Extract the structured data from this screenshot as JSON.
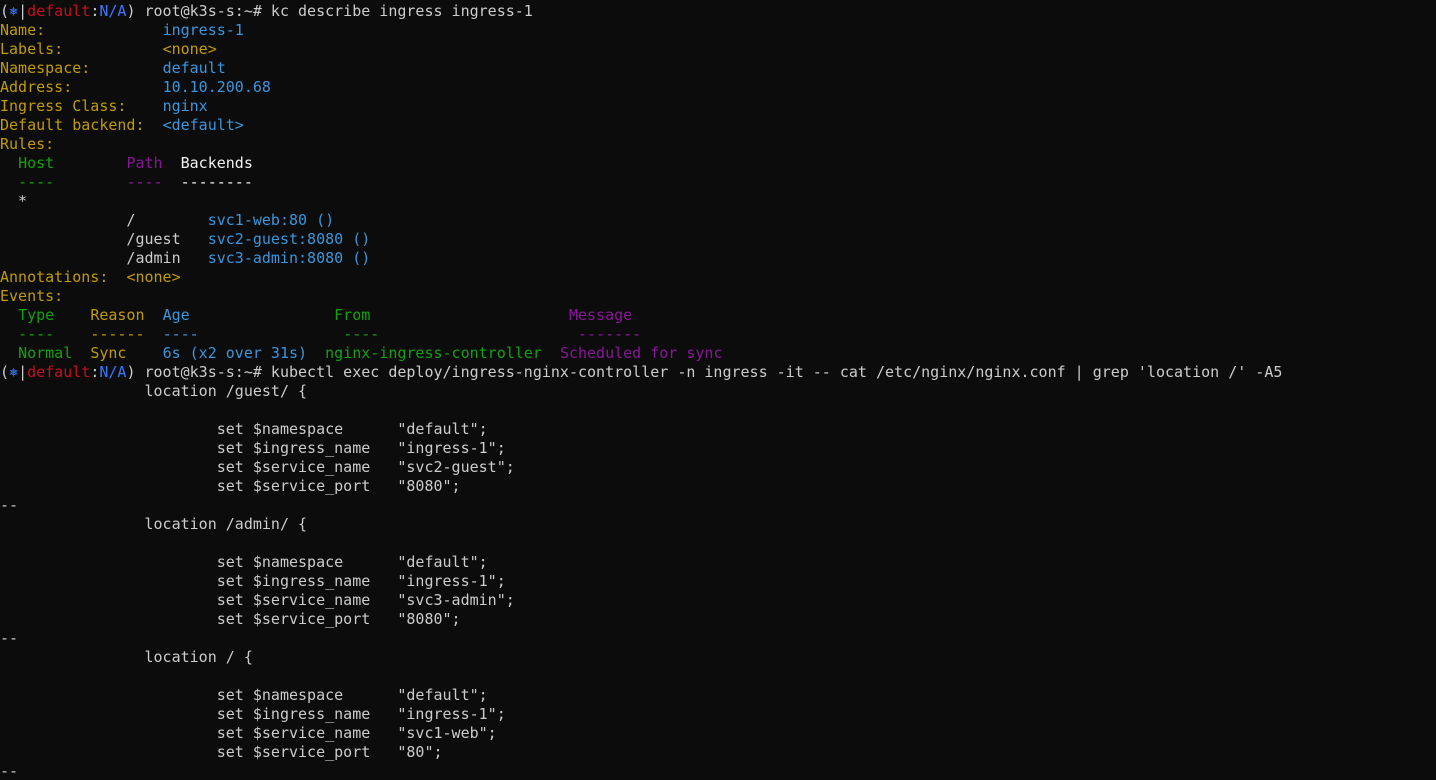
{
  "colors": {
    "background": "#0c0c0c",
    "foreground": "#cccccc",
    "red": "#c50f1f",
    "blue": "#3b78ff",
    "light_blue": "#3a96dd",
    "yellow": "#c19c00",
    "green": "#13a10e",
    "purple": "#881798"
  },
  "icons": {
    "prompt_icon": "kubernetes-wheel-icon"
  },
  "lines": [
    {
      "name": "prompt-line",
      "segments": [
        {
          "t": "(",
          "c": "white"
        },
        {
          "t": "⎈",
          "c": "blue",
          "icon": "kubernetes-wheel-icon"
        },
        {
          "t": "|",
          "c": "white"
        },
        {
          "t": "default",
          "c": "red"
        },
        {
          "t": ":",
          "c": "white"
        },
        {
          "t": "N/A",
          "c": "blue"
        },
        {
          "t": ") root@k3s-s:~# kc describe ingress ingress-1",
          "c": "white"
        }
      ]
    },
    {
      "name": "describe-name",
      "segments": [
        {
          "t": "Name:             ",
          "c": "yellow"
        },
        {
          "t": "ingress-1",
          "c": "lblue"
        }
      ]
    },
    {
      "name": "describe-labels",
      "segments": [
        {
          "t": "Labels:           ",
          "c": "yellow"
        },
        {
          "t": "<none>",
          "c": "yellow"
        }
      ]
    },
    {
      "name": "describe-namespace",
      "segments": [
        {
          "t": "Namespace:        ",
          "c": "yellow"
        },
        {
          "t": "default",
          "c": "lblue"
        }
      ]
    },
    {
      "name": "describe-address",
      "segments": [
        {
          "t": "Address:          ",
          "c": "yellow"
        },
        {
          "t": "10.10.200.68",
          "c": "lblue"
        }
      ]
    },
    {
      "name": "describe-ingress-class",
      "segments": [
        {
          "t": "Ingress Class:    ",
          "c": "yellow"
        },
        {
          "t": "nginx",
          "c": "lblue"
        }
      ]
    },
    {
      "name": "describe-default-backend",
      "segments": [
        {
          "t": "Default backend:  ",
          "c": "yellow"
        },
        {
          "t": "<default>",
          "c": "lblue"
        }
      ]
    },
    {
      "name": "describe-rules",
      "segments": [
        {
          "t": "Rules:",
          "c": "yellow"
        }
      ]
    },
    {
      "name": "rules-header",
      "segments": [
        {
          "t": "  ",
          "c": "white"
        },
        {
          "t": "Host",
          "c": "green"
        },
        {
          "t": "        ",
          "c": "white"
        },
        {
          "t": "Path",
          "c": "purple"
        },
        {
          "t": "  ",
          "c": "white"
        },
        {
          "t": "Backends",
          "c": "bright"
        }
      ]
    },
    {
      "name": "rules-header-underline",
      "segments": [
        {
          "t": "  ",
          "c": "white"
        },
        {
          "t": "----",
          "c": "green"
        },
        {
          "t": "        ",
          "c": "white"
        },
        {
          "t": "----",
          "c": "purple"
        },
        {
          "t": "  ",
          "c": "white"
        },
        {
          "t": "--------",
          "c": "bright"
        }
      ]
    },
    {
      "name": "rules-host",
      "segments": [
        {
          "t": "  *",
          "c": "white"
        }
      ]
    },
    {
      "name": "rules-path-root",
      "segments": [
        {
          "t": "              /        ",
          "c": "white"
        },
        {
          "t": "svc1-web:80 ()",
          "c": "lblue"
        }
      ]
    },
    {
      "name": "rules-path-guest",
      "segments": [
        {
          "t": "              /guest   ",
          "c": "white"
        },
        {
          "t": "svc2-guest:8080 ()",
          "c": "lblue"
        }
      ]
    },
    {
      "name": "rules-path-admin",
      "segments": [
        {
          "t": "              /admin   ",
          "c": "white"
        },
        {
          "t": "svc3-admin:8080 ()",
          "c": "lblue"
        }
      ]
    },
    {
      "name": "describe-annotations",
      "segments": [
        {
          "t": "Annotations:  ",
          "c": "yellow"
        },
        {
          "t": "<none>",
          "c": "yellow"
        }
      ]
    },
    {
      "name": "describe-events",
      "segments": [
        {
          "t": "Events:",
          "c": "yellow"
        }
      ]
    },
    {
      "name": "events-header",
      "segments": [
        {
          "t": "  ",
          "c": "white"
        },
        {
          "t": "Type",
          "c": "green"
        },
        {
          "t": "    ",
          "c": "white"
        },
        {
          "t": "Reason",
          "c": "yellow"
        },
        {
          "t": "  ",
          "c": "white"
        },
        {
          "t": "Age",
          "c": "lblue"
        },
        {
          "t": "                ",
          "c": "white"
        },
        {
          "t": "From",
          "c": "green"
        },
        {
          "t": "                      ",
          "c": "white"
        },
        {
          "t": "Message",
          "c": "purple"
        }
      ]
    },
    {
      "name": "events-header-underline",
      "segments": [
        {
          "t": "  ",
          "c": "white"
        },
        {
          "t": "----",
          "c": "green"
        },
        {
          "t": "    ",
          "c": "white"
        },
        {
          "t": "------",
          "c": "yellow"
        },
        {
          "t": "  ",
          "c": "white"
        },
        {
          "t": "----",
          "c": "lblue"
        },
        {
          "t": "                ",
          "c": "white"
        },
        {
          "t": "----",
          "c": "green"
        },
        {
          "t": "                      ",
          "c": "white"
        },
        {
          "t": "-------",
          "c": "purple"
        }
      ]
    },
    {
      "name": "events-row",
      "segments": [
        {
          "t": "  ",
          "c": "white"
        },
        {
          "t": "Normal",
          "c": "green"
        },
        {
          "t": "  ",
          "c": "white"
        },
        {
          "t": "Sync",
          "c": "yellow"
        },
        {
          "t": "    ",
          "c": "white"
        },
        {
          "t": "6s (x2 over 31s)",
          "c": "lblue"
        },
        {
          "t": "  ",
          "c": "white"
        },
        {
          "t": "nginx-ingress-controller",
          "c": "green"
        },
        {
          "t": "  ",
          "c": "white"
        },
        {
          "t": "Scheduled for sync",
          "c": "purple"
        }
      ]
    },
    {
      "name": "prompt-line",
      "segments": [
        {
          "t": "(",
          "c": "white"
        },
        {
          "t": "⎈",
          "c": "blue",
          "icon": "kubernetes-wheel-icon"
        },
        {
          "t": "|",
          "c": "white"
        },
        {
          "t": "default",
          "c": "red"
        },
        {
          "t": ":",
          "c": "white"
        },
        {
          "t": "N/A",
          "c": "blue"
        },
        {
          "t": ") root@k3s-s:~# kubectl exec deploy/ingress-nginx-controller -n ingress -it -- cat /etc/nginx/nginx.conf | grep 'location /' -A5",
          "c": "white"
        }
      ]
    },
    {
      "name": "output-line",
      "segments": [
        {
          "t": "                location /guest/ {",
          "c": "white"
        }
      ]
    },
    {
      "name": "output-line",
      "segments": [
        {
          "t": "",
          "c": "white"
        }
      ]
    },
    {
      "name": "output-line",
      "segments": [
        {
          "t": "                        set $namespace      \"default\";",
          "c": "white"
        }
      ]
    },
    {
      "name": "output-line",
      "segments": [
        {
          "t": "                        set $ingress_name   \"ingress-1\";",
          "c": "white"
        }
      ]
    },
    {
      "name": "output-line",
      "segments": [
        {
          "t": "                        set $service_name   \"svc2-guest\";",
          "c": "white"
        }
      ]
    },
    {
      "name": "output-line",
      "segments": [
        {
          "t": "                        set $service_port   \"8080\";",
          "c": "white"
        }
      ]
    },
    {
      "name": "output-separator",
      "segments": [
        {
          "t": "--",
          "c": "white"
        }
      ]
    },
    {
      "name": "output-line",
      "segments": [
        {
          "t": "                location /admin/ {",
          "c": "white"
        }
      ]
    },
    {
      "name": "output-line",
      "segments": [
        {
          "t": "",
          "c": "white"
        }
      ]
    },
    {
      "name": "output-line",
      "segments": [
        {
          "t": "                        set $namespace      \"default\";",
          "c": "white"
        }
      ]
    },
    {
      "name": "output-line",
      "segments": [
        {
          "t": "                        set $ingress_name   \"ingress-1\";",
          "c": "white"
        }
      ]
    },
    {
      "name": "output-line",
      "segments": [
        {
          "t": "                        set $service_name   \"svc3-admin\";",
          "c": "white"
        }
      ]
    },
    {
      "name": "output-line",
      "segments": [
        {
          "t": "                        set $service_port   \"8080\";",
          "c": "white"
        }
      ]
    },
    {
      "name": "output-separator",
      "segments": [
        {
          "t": "--",
          "c": "white"
        }
      ]
    },
    {
      "name": "output-line",
      "segments": [
        {
          "t": "                location / {",
          "c": "white"
        }
      ]
    },
    {
      "name": "output-line",
      "segments": [
        {
          "t": "",
          "c": "white"
        }
      ]
    },
    {
      "name": "output-line",
      "segments": [
        {
          "t": "                        set $namespace      \"default\";",
          "c": "white"
        }
      ]
    },
    {
      "name": "output-line",
      "segments": [
        {
          "t": "                        set $ingress_name   \"ingress-1\";",
          "c": "white"
        }
      ]
    },
    {
      "name": "output-line",
      "segments": [
        {
          "t": "                        set $service_name   \"svc1-web\";",
          "c": "white"
        }
      ]
    },
    {
      "name": "output-line",
      "segments": [
        {
          "t": "                        set $service_port   \"80\";",
          "c": "white"
        }
      ]
    },
    {
      "name": "output-separator",
      "segments": [
        {
          "t": "--",
          "c": "white"
        }
      ]
    }
  ]
}
